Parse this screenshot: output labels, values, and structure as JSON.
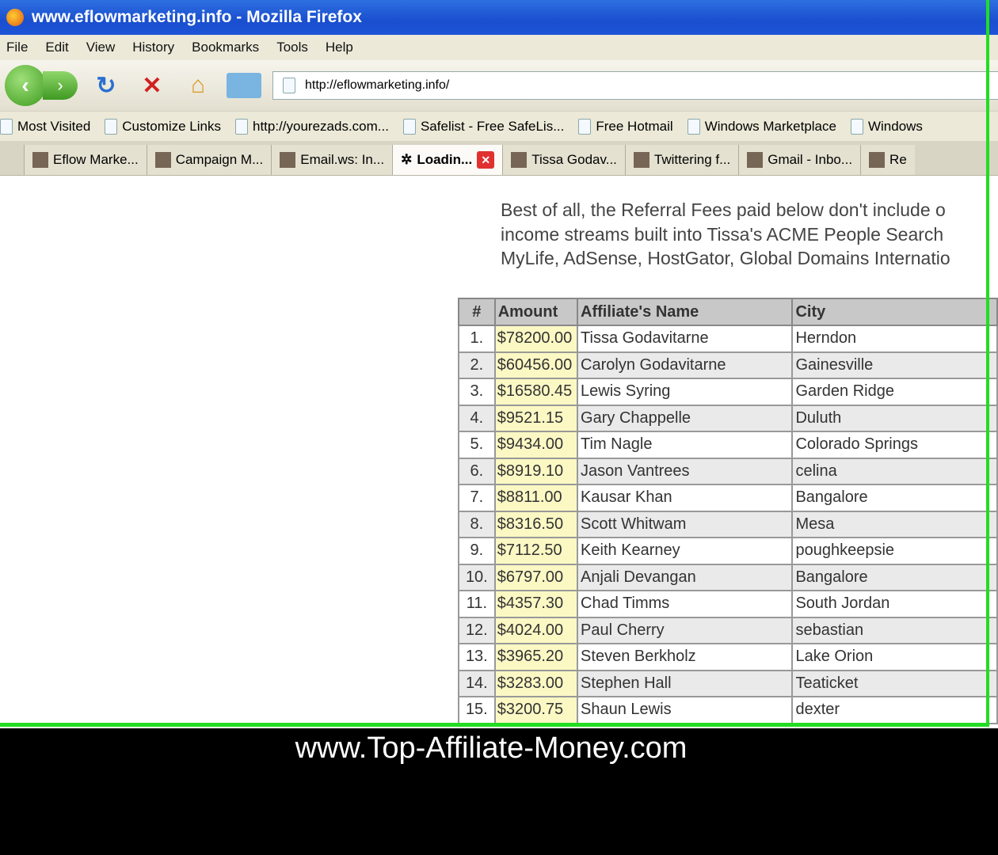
{
  "window": {
    "title": "www.eflowmarketing.info - Mozilla Firefox"
  },
  "menu": [
    "File",
    "Edit",
    "View",
    "History",
    "Bookmarks",
    "Tools",
    "Help"
  ],
  "url": "http://eflowmarketing.info/",
  "bookmarks": [
    "Most Visited",
    "Customize Links",
    "http://yourezads.com...",
    "Safelist - Free SafeLis...",
    "Free Hotmail",
    "Windows Marketplace",
    "Windows"
  ],
  "tabs": [
    {
      "label": "Eflow Marke..."
    },
    {
      "label": "Campaign M..."
    },
    {
      "label": "Email.ws: In..."
    },
    {
      "label": "Loadin...",
      "active": true
    },
    {
      "label": "Tissa Godav..."
    },
    {
      "label": "Twittering f..."
    },
    {
      "label": "Gmail - Inbo..."
    },
    {
      "label": "Re"
    }
  ],
  "intro": [
    "Best of all, the Referral Fees paid below don't include o",
    "income streams built into Tissa's ACME People Search",
    "MyLife, AdSense, HostGator, Global Domains Internatio"
  ],
  "table": {
    "headers": [
      "#",
      "Amount",
      "Affiliate's Name",
      "City"
    ],
    "rows": [
      [
        "1.",
        "$78200.00",
        "Tissa Godavitarne",
        "Herndon"
      ],
      [
        "2.",
        "$60456.00",
        "Carolyn Godavitarne",
        "Gainesville"
      ],
      [
        "3.",
        "$16580.45",
        "Lewis Syring",
        "Garden Ridge"
      ],
      [
        "4.",
        "$9521.15",
        "Gary Chappelle",
        "Duluth"
      ],
      [
        "5.",
        "$9434.00",
        "Tim Nagle",
        "Colorado Springs"
      ],
      [
        "6.",
        "$8919.10",
        "Jason Vantrees",
        "celina"
      ],
      [
        "7.",
        "$8811.00",
        "Kausar Khan",
        "Bangalore"
      ],
      [
        "8.",
        "$8316.50",
        "Scott Whitwam",
        "Mesa"
      ],
      [
        "9.",
        "$7112.50",
        "Keith Kearney",
        "poughkeepsie"
      ],
      [
        "10.",
        "$6797.00",
        "Anjali Devangan",
        "Bangalore"
      ],
      [
        "11.",
        "$4357.30",
        "Chad Timms",
        "South Jordan"
      ],
      [
        "12.",
        "$4024.00",
        "Paul Cherry",
        "sebastian"
      ],
      [
        "13.",
        "$3965.20",
        "Steven Berkholz",
        "Lake Orion"
      ],
      [
        "14.",
        "$3283.00",
        "Stephen Hall",
        "Teaticket"
      ],
      [
        "15.",
        "$3200.75",
        "Shaun Lewis",
        "dexter"
      ]
    ]
  },
  "footer": "www.Top-Affiliate-Money.com"
}
